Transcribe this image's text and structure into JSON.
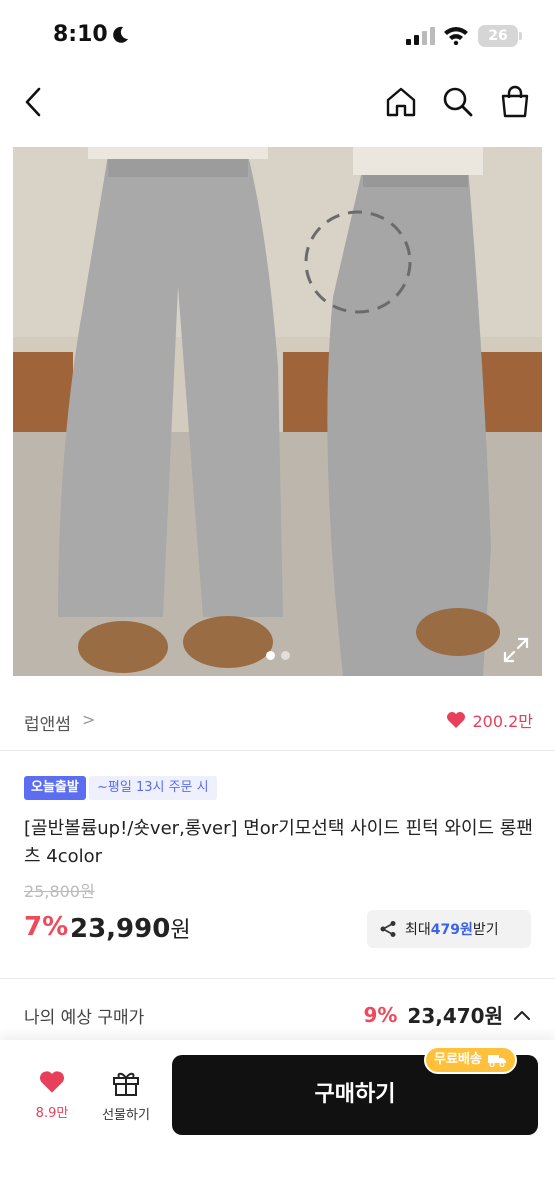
{
  "status_bar": {
    "time": "8:10",
    "battery": "26"
  },
  "nav": {
    "back_icon": "chevron-left-icon",
    "home_icon": "home-icon",
    "search_icon": "search-icon",
    "cart_icon": "shopping-bag-icon"
  },
  "gallery": {
    "page_count": 2,
    "active_index": 0
  },
  "brand": {
    "name": "럽앤썸",
    "chevron": ">",
    "likes": "200.2만"
  },
  "shipping": {
    "badge": "오늘출발",
    "note": "~평일 13시 주문 시"
  },
  "product": {
    "title": "[골반볼륨up!/숏ver,롱ver] 면or기모선택 사이드 핀턱 와이드 롱팬츠 4color",
    "original_price": "25,800원",
    "discount": "7%",
    "price": "23,990",
    "price_unit": "원"
  },
  "reward": {
    "prefix": "최대 ",
    "amount": "479원",
    "suffix": " 받기"
  },
  "estimate": {
    "label": "나의 예상 구매가",
    "discount": "9%",
    "price": "23,470원"
  },
  "bottom_bar": {
    "like_count": "8.9만",
    "gift_label": "선물하기",
    "buy_label": "구매하기",
    "free_shipping": "무료배송"
  },
  "colors": {
    "accent_red": "#ef4a5b",
    "heart": "#e8405a",
    "badge_blue": "#5b6df1",
    "reward_blue": "#3b62e8",
    "buy_button": "#111111",
    "free_badge": "#ffc13b"
  }
}
